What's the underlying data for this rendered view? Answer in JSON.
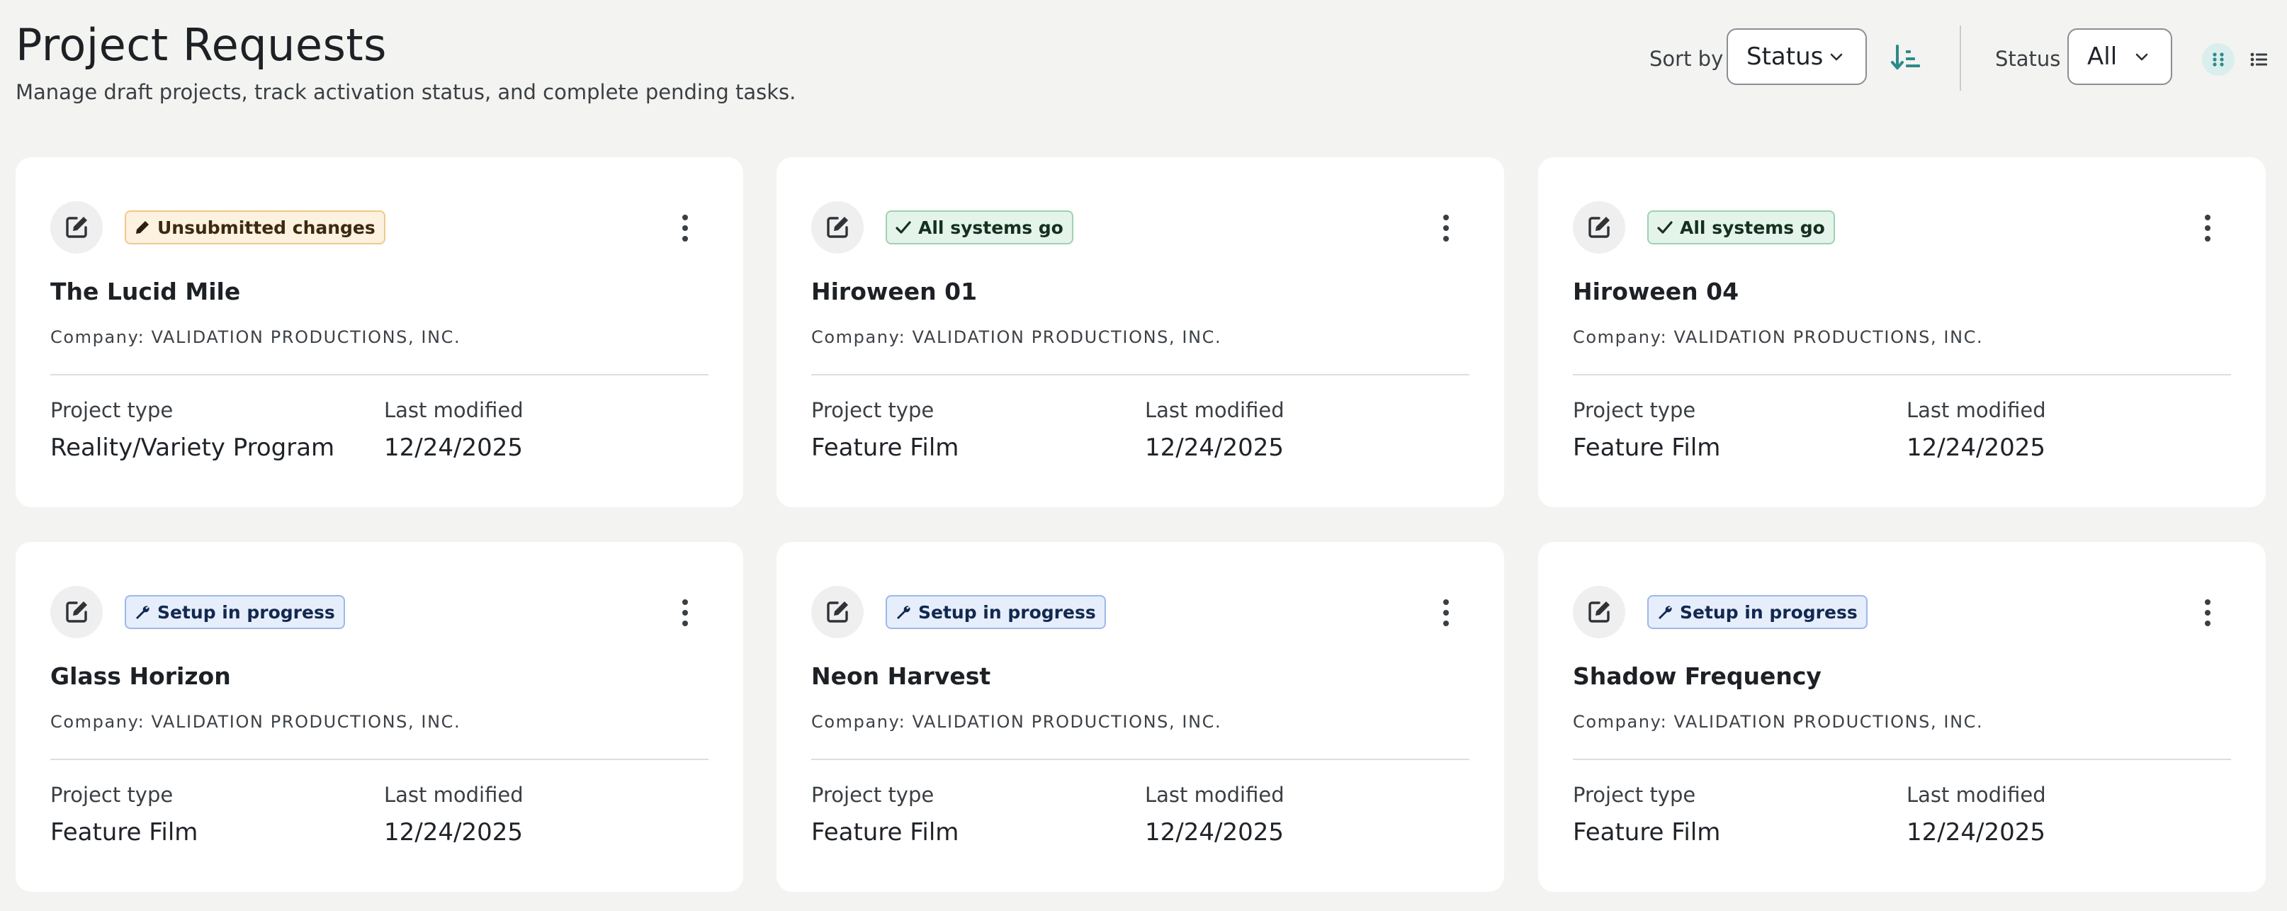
{
  "header": {
    "title": "Project Requests",
    "subtitle": "Manage draft projects, track activation status, and complete pending tasks."
  },
  "controls": {
    "sort_label": "Sort by",
    "sort_value": "Status",
    "status_label": "Status",
    "status_value": "All",
    "accent_color": "#2d8a8a",
    "view_mode": "grid"
  },
  "card_labels": {
    "project_type": "Project type",
    "last_modified": "Last modified"
  },
  "projects": [
    {
      "title": "The Lucid Mile",
      "company": "Company: VALIDATION PRODUCTIONS, INC.",
      "status": "Unsubmitted changes",
      "status_kind": "warn",
      "project_type": "Reality/Variety Program",
      "last_modified": "12/24/2025"
    },
    {
      "title": "Hiroween 01",
      "company": "Company: VALIDATION PRODUCTIONS, INC.",
      "status": "All systems go",
      "status_kind": "ok",
      "project_type": "Feature Film",
      "last_modified": "12/24/2025"
    },
    {
      "title": "Hiroween 04",
      "company": "Company: VALIDATION PRODUCTIONS, INC.",
      "status": "All systems go",
      "status_kind": "ok",
      "project_type": "Feature Film",
      "last_modified": "12/24/2025"
    },
    {
      "title": "Glass Horizon",
      "company": "Company: VALIDATION PRODUCTIONS, INC.",
      "status": "Setup in progress",
      "status_kind": "info",
      "project_type": "Feature Film",
      "last_modified": "12/24/2025"
    },
    {
      "title": "Neon Harvest",
      "company": "Company: VALIDATION PRODUCTIONS, INC.",
      "status": "Setup in progress",
      "status_kind": "info",
      "project_type": "Feature Film",
      "last_modified": "12/24/2025"
    },
    {
      "title": "Shadow Frequency",
      "company": "Company: VALIDATION PRODUCTIONS, INC.",
      "status": "Setup in progress",
      "status_kind": "info",
      "project_type": "Feature Film",
      "last_modified": "12/24/2025"
    }
  ]
}
